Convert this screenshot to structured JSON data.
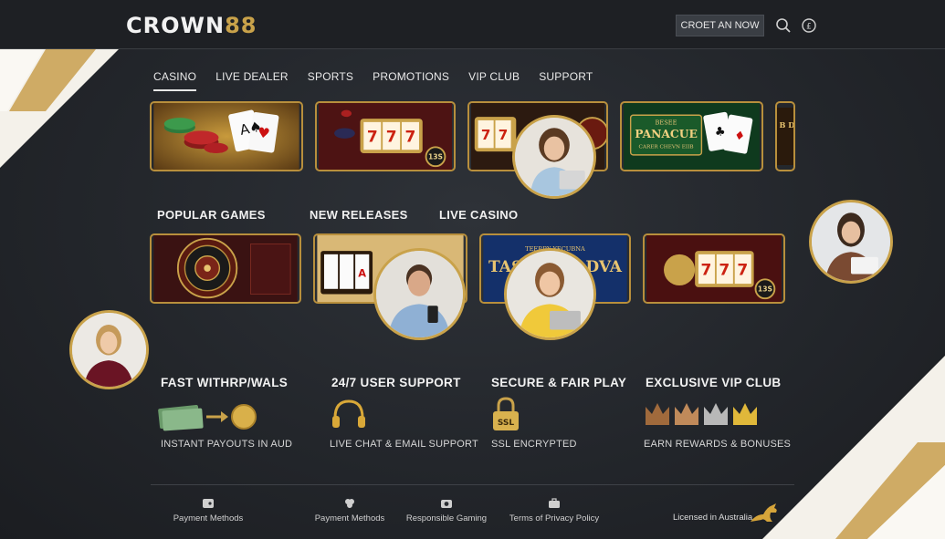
{
  "header": {
    "logo_text": "CROWN",
    "logo_number": "88",
    "cta_label": "CROET AN NOW",
    "icons": [
      "search-icon",
      "coin-icon"
    ]
  },
  "nav": {
    "items": [
      {
        "label": "CASINO",
        "active": true
      },
      {
        "label": "LIVE DEALER",
        "active": false
      },
      {
        "label": "SPORTS",
        "active": false
      },
      {
        "label": "PROMOTIONS",
        "active": false
      },
      {
        "label": "VIP CLUB",
        "active": false
      },
      {
        "label": "SUPPORT",
        "active": false
      }
    ]
  },
  "featured_tiles": {
    "slot_badge": "13S",
    "board_top": "BESEE",
    "board_main": "PANACUE",
    "board_sub": "CARER CHEVN EIIB",
    "partial_text": "B DN"
  },
  "sections": {
    "popular": "POPULAR GAMES",
    "new_releases": "NEW RELEASES",
    "live_casino": "LIVE CASINO"
  },
  "game_tiles": {
    "banner_top": "TEERRY YECUBNA",
    "banner_left": "TAS",
    "banner_right": "ADVA",
    "slot_badge": "13S"
  },
  "features": [
    {
      "title": "FAST WITHRP/WALS",
      "subtitle": "INSTANT PAYOUTS IN AUD",
      "icon": "cash-coin-icon"
    },
    {
      "title": "24/7 USER SUPPORT",
      "subtitle": "LIVE CHAT & EMAIL SUPPORT",
      "icon": "headset-icon"
    },
    {
      "title": "SECURE & FAIR PLAY",
      "subtitle": "SSL ENCRYPTED",
      "icon": "ssl-lock-icon",
      "badge": "SSL"
    },
    {
      "title": "EXCLUSIVE VIP CLUB",
      "subtitle": "EARN REWARDS & BONUSES",
      "icon": "crowns-icon"
    }
  ],
  "footer": {
    "items": [
      {
        "label": "Payment Methods",
        "icon": "wallet-icon"
      },
      {
        "label": "Payment Methods",
        "icon": "clover-icon"
      },
      {
        "label": "Responsible Gaming",
        "icon": "camera-icon"
      },
      {
        "label": "Terms of Privacy Policy",
        "icon": "briefcase-icon"
      }
    ],
    "licensed": "Licensed in Australia"
  },
  "colors": {
    "gold": "#c9a24a",
    "background": "#25282d",
    "header": "#1e2024"
  }
}
